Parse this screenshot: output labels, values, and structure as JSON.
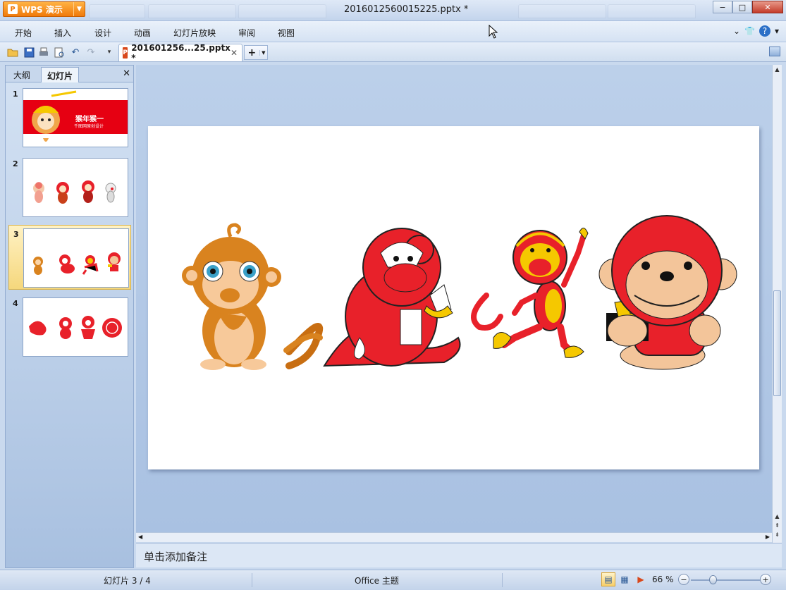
{
  "app": {
    "button_label": "WPS 演示",
    "window_title": "2016012560015225.pptx *"
  },
  "window_controls": {
    "minimize": "−",
    "maximize": "□",
    "close": "✕"
  },
  "menu": {
    "items": [
      "开始",
      "插入",
      "设计",
      "动画",
      "幻灯片放映",
      "审阅",
      "视图"
    ],
    "right_icons": [
      "chevron-down-icon",
      "skin-icon",
      "help-icon"
    ]
  },
  "toolbar": {
    "icons": [
      "open-icon",
      "save-icon",
      "print-icon",
      "print-preview-icon",
      "undo-icon",
      "redo-icon",
      "customize-icon"
    ],
    "doc_tab_label": "201601256...25.pptx *",
    "doc_tab_close": "✕",
    "new_tab": "+"
  },
  "left_panel": {
    "tabs": [
      "大纲",
      "幻灯片"
    ],
    "active_tab": "幻灯片",
    "close": "✕",
    "slides": [
      {
        "num": "1",
        "title": "猴年猴一",
        "subtitle": "千图网原创设计"
      },
      {
        "num": "2"
      },
      {
        "num": "3",
        "selected": true
      },
      {
        "num": "4"
      }
    ]
  },
  "notes": {
    "placeholder": "单击添加备注"
  },
  "statusbar": {
    "slide_indicator": "幻灯片 3 / 4",
    "theme": "Office 主题",
    "zoom": "66 %",
    "zoom_out": "−",
    "zoom_in": "+"
  },
  "colors": {
    "accent": "#f07a0b",
    "monkey_red": "#e8212a",
    "monkey_brown": "#d9831f",
    "yellow": "#f5c800"
  }
}
